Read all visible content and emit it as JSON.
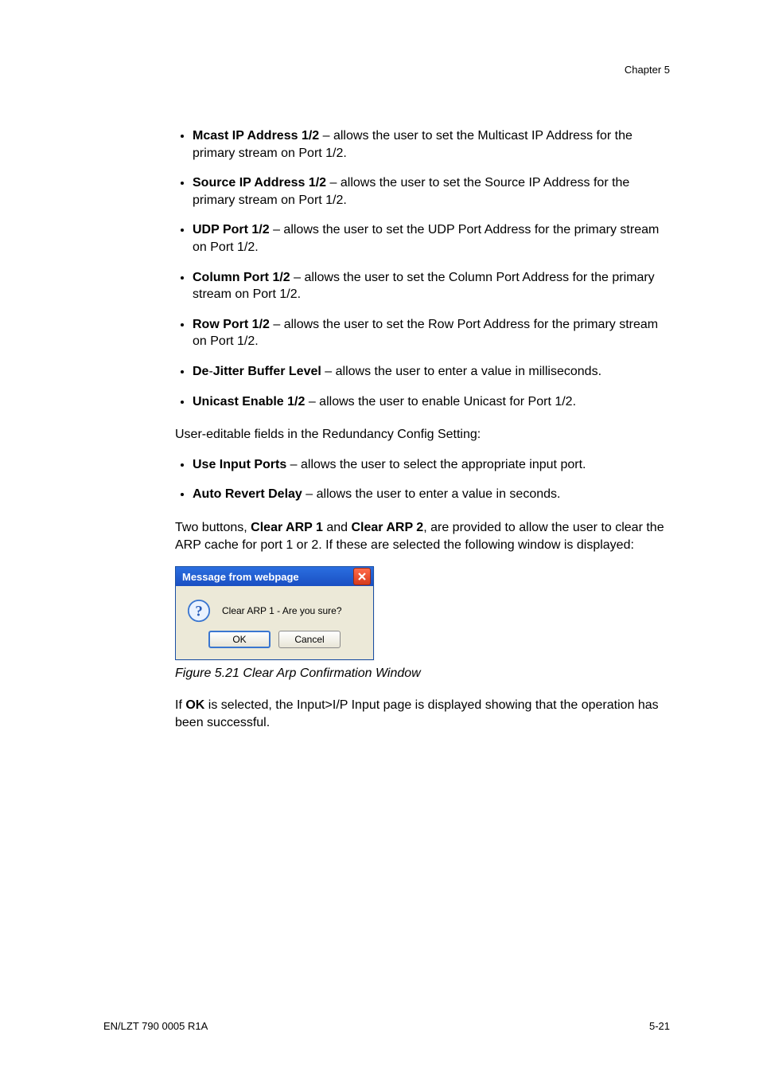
{
  "chapter_label": "Chapter 5",
  "bullets_main": [
    {
      "lead": "Mcast IP Address 1/2",
      "rest": " – allows the user to set the Multicast IP Address for the primary stream on Port 1/2."
    },
    {
      "lead": "Source IP Address 1/2",
      "rest": " – allows the user to set the Source IP Address for the primary stream on Port 1/2."
    },
    {
      "lead": "UDP Port 1/2",
      "rest": " – allows the user to set the UDP Port Address for the primary stream on Port 1/2."
    },
    {
      "lead": "Column Port 1/2",
      "rest": " – allows the user to set the Column Port Address for the primary stream on Port 1/2."
    },
    {
      "lead": "Row Port 1/2",
      "rest": " – allows the user to set the Row Port Address for the primary stream on Port 1/2."
    },
    {
      "lead": "De",
      "mid": "-",
      "lead2": "Jitter Buffer Level",
      "rest": " – allows the user to enter a value in milliseconds."
    },
    {
      "lead": "Unicast Enable 1/2",
      "rest": " – allows the user to enable Unicast for Port 1/2."
    }
  ],
  "para_redundancy": "User-editable fields in the Redundancy Config Setting:",
  "bullets_redundancy": [
    {
      "lead": "Use Input Ports",
      "rest": " – allows the user to select the appropriate input port."
    },
    {
      "lead": "Auto Revert Delay",
      "rest": " – allows the user to enter a value in seconds."
    }
  ],
  "para_two_buttons_pre": "Two buttons, ",
  "btn1_label": "Clear ARP 1",
  "para_two_buttons_mid": " and ",
  "btn2_label": "Clear ARP 2",
  "para_two_buttons_post": ", are provided to allow the user to clear the ARP cache for port 1 or 2. If these are selected the following window is displayed:",
  "dialog": {
    "title": "Message from webpage",
    "body": "Clear ARP 1 - Are you sure?",
    "ok": "OK",
    "cancel": "Cancel"
  },
  "figure_caption_label": "Figure 5.21",
  "figure_caption_text": "Clear Arp Confirmation Window",
  "para_final_pre": "If ",
  "para_final_bold": "OK",
  "para_final_post": " is selected, the Input>I/P Input page is displayed showing that the operation has been successful.",
  "footer_left": "EN/LZT 790 0005 R1A",
  "footer_right": "5-21"
}
